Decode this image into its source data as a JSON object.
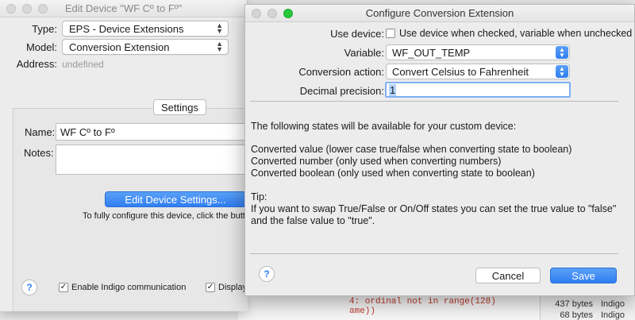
{
  "background": {
    "log_lines": [
      "4: ordinal not in range(128)",
      "ame))"
    ],
    "side_rows": [
      {
        "size": "437 bytes",
        "owner": "Indigo"
      },
      {
        "size": "68 bytes",
        "owner": "Indigo"
      }
    ]
  },
  "edit_device": {
    "title": "Edit Device \"WF Cº to Fº\"",
    "type_label": "Type:",
    "type_value": "EPS - Device Extensions",
    "model_label": "Model:",
    "model_value": "Conversion Extension",
    "address_label": "Address:",
    "address_value": "undefined",
    "settings_button": "Settings",
    "name_label": "Name:",
    "name_value": "WF Cº to Fº",
    "notes_label": "Notes:",
    "edit_settings_button": "Edit Device Settings...",
    "hint_text": "To fully configure this device, click the butto",
    "help_glyph": "?",
    "enable_indigo_label": "Enable Indigo communication",
    "display_label": "Display"
  },
  "config": {
    "title": "Configure Conversion Extension",
    "use_device_label": "Use device:",
    "use_device_text": "Use device when checked, variable when unchecked",
    "variable_label": "Variable:",
    "variable_value": "WF_OUT_TEMP",
    "conversion_action_label": "Conversion action:",
    "conversion_action_value": "Convert Celsius to Fahrenheit",
    "decimal_precision_label": "Decimal precision:",
    "decimal_precision_value": "1",
    "states_intro": "The following states will be available for your custom device:",
    "state_lines": [
      "Converted value (lower case true/false when converting state to boolean)",
      "Converted number (only used when converting numbers)",
      "Converted boolean (only used when converting state to boolean)"
    ],
    "tip_heading": "Tip:",
    "tip_lines": [
      "If you want to swap True/False or On/Off states you can set the true value to \"false\"",
      "and the false value to \"true\"."
    ],
    "help_glyph": "?",
    "cancel_button": "Cancel",
    "save_button": "Save"
  }
}
